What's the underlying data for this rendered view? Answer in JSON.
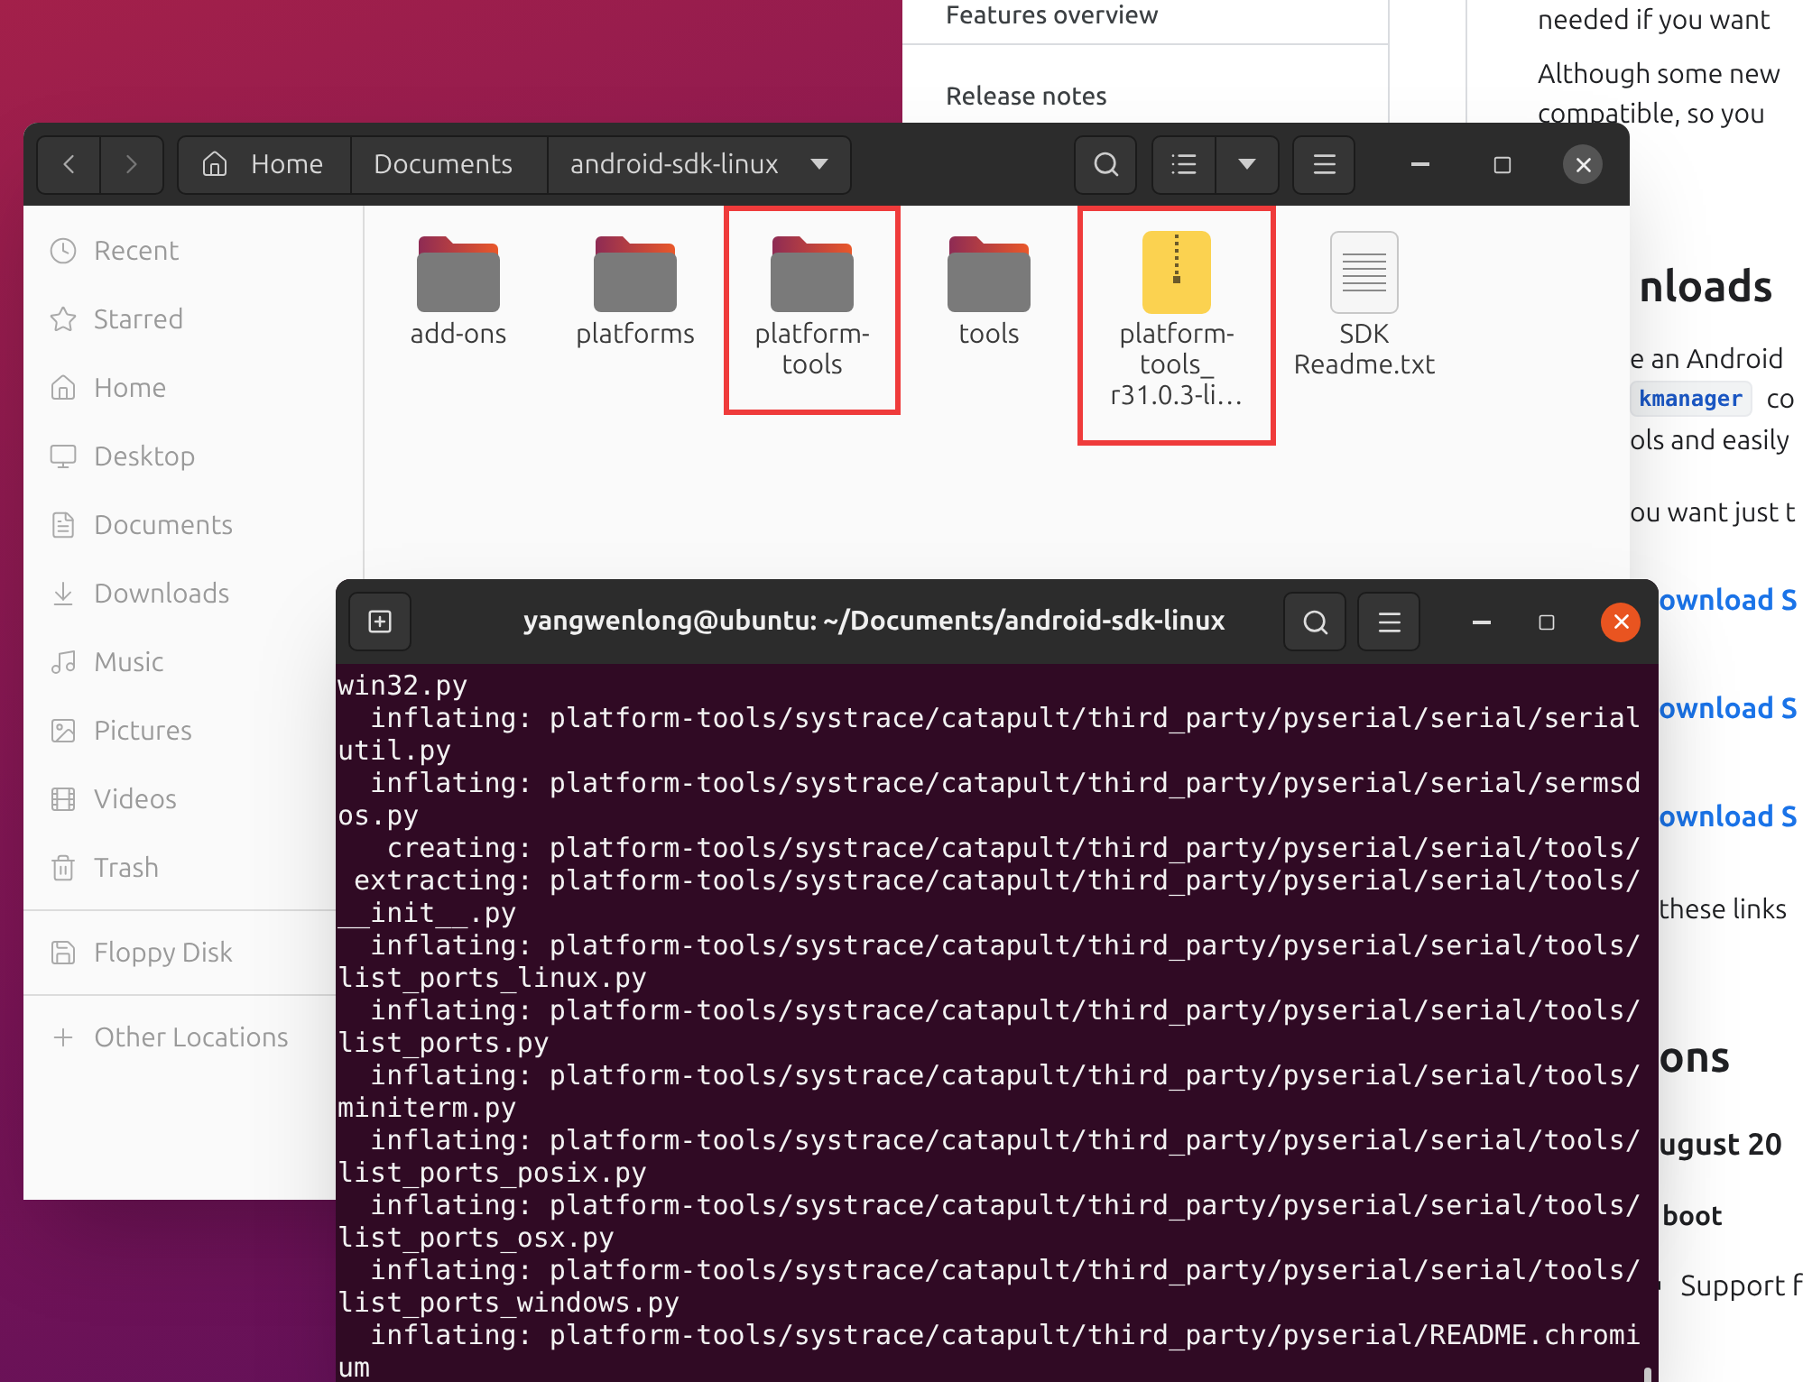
{
  "browser": {
    "nav": [
      {
        "label": "Features overview"
      },
      {
        "label": "Release notes"
      }
    ],
    "content": [
      {
        "kind": "para",
        "text": "needed if you want"
      },
      {
        "kind": "para",
        "text": "Although some new"
      },
      {
        "kind": "para",
        "text": "compatible, so you"
      },
      {
        "kind": "heading",
        "text": "nloads"
      },
      {
        "kind": "para",
        "text": "e an Android"
      },
      {
        "kind": "code",
        "text": "kmanager",
        "after": "co"
      },
      {
        "kind": "para",
        "text": "ols and easily"
      },
      {
        "kind": "para",
        "text": "ou want just t"
      },
      {
        "kind": "link",
        "text": "ownload S"
      },
      {
        "kind": "link",
        "text": "ownload S"
      },
      {
        "kind": "link",
        "text": "ownload S"
      },
      {
        "kind": "para",
        "text": "these links"
      },
      {
        "kind": "heading",
        "text": "ons"
      },
      {
        "kind": "subheading",
        "text": "ugust 20"
      },
      {
        "kind": "bold",
        "text": "boot"
      },
      {
        "kind": "bullet",
        "text": "Support f"
      }
    ]
  },
  "files": {
    "path": [
      "Home",
      "Documents",
      "android-sdk-linux"
    ],
    "sidebar": [
      {
        "label": "Recent"
      },
      {
        "label": "Starred"
      },
      {
        "label": "Home"
      },
      {
        "label": "Desktop"
      },
      {
        "label": "Documents"
      },
      {
        "label": "Downloads"
      },
      {
        "label": "Music"
      },
      {
        "label": "Pictures"
      },
      {
        "label": "Videos"
      },
      {
        "label": "Trash"
      },
      {
        "label": "Floppy Disk"
      },
      {
        "label": "Other Locations"
      }
    ],
    "items": [
      {
        "kind": "folder",
        "name": "add-ons",
        "highlighted": false
      },
      {
        "kind": "folder",
        "name": "platforms",
        "highlighted": false
      },
      {
        "kind": "folder",
        "name": "platform-\ntools",
        "highlighted": true
      },
      {
        "kind": "folder",
        "name": "tools",
        "highlighted": false
      },
      {
        "kind": "archive",
        "name": "platform-\ntools_\nr31.0.3-li…",
        "highlighted": true
      },
      {
        "kind": "text",
        "name": "SDK\nReadme.txt",
        "highlighted": false
      }
    ]
  },
  "terminal": {
    "title": "yangwenlong@ubuntu: ~/Documents/android-sdk-linux",
    "lines": [
      "win32.py",
      "  inflating: platform-tools/systrace/catapult/third_party/pyserial/serial/serial",
      "util.py",
      "  inflating: platform-tools/systrace/catapult/third_party/pyserial/serial/sermsd",
      "os.py",
      "   creating: platform-tools/systrace/catapult/third_party/pyserial/serial/tools/",
      " extracting: platform-tools/systrace/catapult/third_party/pyserial/serial/tools/",
      "__init__.py",
      "  inflating: platform-tools/systrace/catapult/third_party/pyserial/serial/tools/",
      "list_ports_linux.py",
      "  inflating: platform-tools/systrace/catapult/third_party/pyserial/serial/tools/",
      "list_ports.py",
      "  inflating: platform-tools/systrace/catapult/third_party/pyserial/serial/tools/",
      "miniterm.py",
      "  inflating: platform-tools/systrace/catapult/third_party/pyserial/serial/tools/",
      "list_ports_posix.py",
      "  inflating: platform-tools/systrace/catapult/third_party/pyserial/serial/tools/",
      "list_ports_osx.py",
      "  inflating: platform-tools/systrace/catapult/third_party/pyserial/serial/tools/",
      "list_ports_windows.py",
      "  inflating: platform-tools/systrace/catapult/third_party/pyserial/README.chromi",
      "um"
    ]
  }
}
